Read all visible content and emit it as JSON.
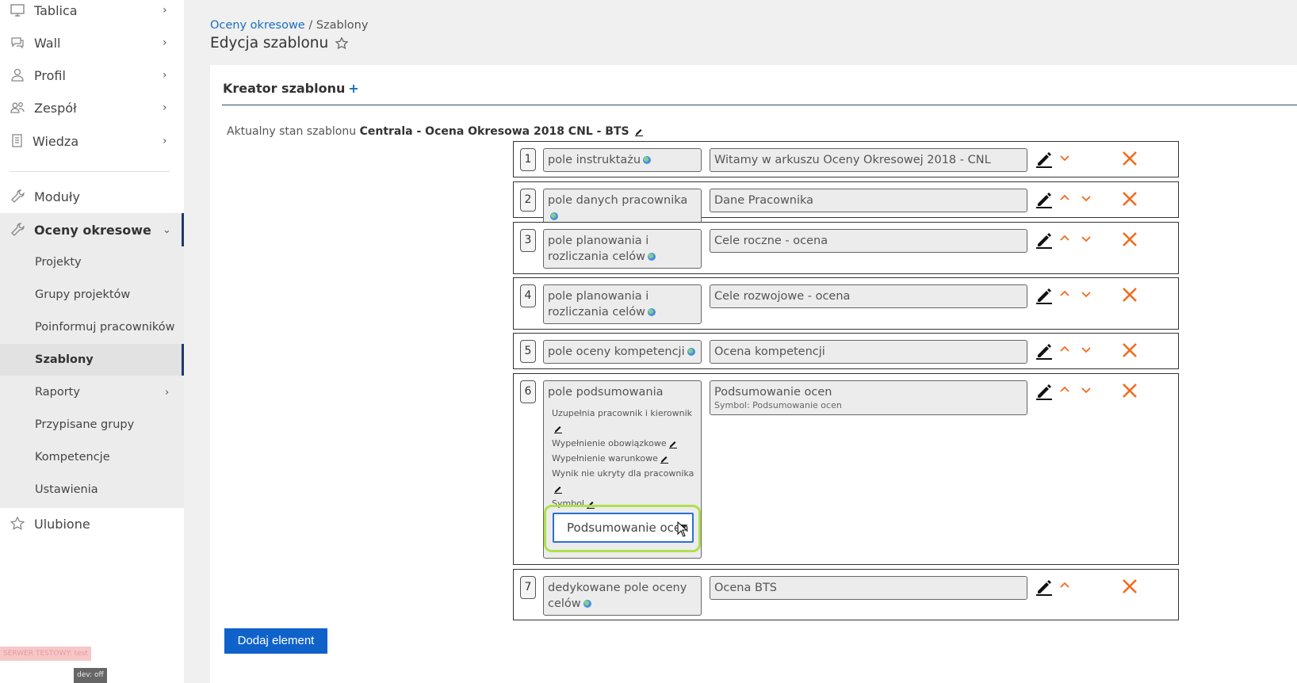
{
  "sidebar": {
    "items": [
      {
        "label": "Tablica",
        "icon": "monitor-icon"
      },
      {
        "label": "Wall",
        "icon": "chat-icon"
      },
      {
        "label": "Profil",
        "icon": "user-icon"
      },
      {
        "label": "Zespół",
        "icon": "team-icon"
      },
      {
        "label": "Wiedza",
        "icon": "book-icon"
      },
      {
        "label": "Moduły",
        "icon": "wrench-icon"
      },
      {
        "label": "Oceny okresowe",
        "icon": "wrench-icon"
      }
    ],
    "submenu": [
      {
        "label": "Projekty"
      },
      {
        "label": "Grupy projektów"
      },
      {
        "label": "Poinformuj pracowników"
      },
      {
        "label": "Szablony"
      },
      {
        "label": "Raporty"
      },
      {
        "label": "Przypisane grupy"
      },
      {
        "label": "Kompetencje"
      },
      {
        "label": "Ustawienia"
      }
    ],
    "favorites": {
      "label": "Ulubione",
      "icon": "star-icon"
    },
    "server_badge": "SERWER TESTOWY: test",
    "dev_badge": "dev: off"
  },
  "breadcrumb": {
    "parent": "Oceny okresowe",
    "separator": " / ",
    "current": "Szablony"
  },
  "page_title": "Edycja szablonu",
  "card": {
    "title": "Kreator szablonu",
    "plus": "+",
    "state_prefix": "Aktualny stan szablonu",
    "state_name": "Centrala - Ocena Okresowa 2018 CNL - BTS"
  },
  "rows": [
    {
      "num": "1",
      "type": "pole instruktażu",
      "name": "Witamy w arkuszu Oceny Okresowej 2018 - CNL"
    },
    {
      "num": "2",
      "type": "pole danych pracownika",
      "name": "Dane Pracownika"
    },
    {
      "num": "3",
      "type": "pole planowania i rozliczania celów",
      "name": "Cele roczne - ocena"
    },
    {
      "num": "4",
      "type": "pole planowania i rozliczania celów",
      "name": "Cele rozwojowe - ocena"
    },
    {
      "num": "5",
      "type": "pole oceny kompetencji",
      "name": "Ocena kompetencji"
    },
    {
      "num": "6",
      "type": "pole podsumowania",
      "name": "Podsumowanie ocen",
      "symbol_line": "Symbol: Podsumowanie ocen",
      "options": [
        "Uzupełnia pracownik i kierownik",
        "Wypełnienie obowiązkowe",
        "Wypełnienie warunkowe",
        "Wynik nie ukryty dla pracownika",
        "Symbol"
      ],
      "symbol_select_value": "Podsumowanie ocen"
    },
    {
      "num": "7",
      "type": "dedykowane pole oceny celów",
      "name": "Ocena BTS"
    }
  ],
  "add_button": "Dodaj element",
  "colors": {
    "accent": "#1a6fbf",
    "button": "#0f62c9",
    "delete": "#f26b1d",
    "highlight": "#aee04c",
    "nav_active": "#1f3a6b"
  }
}
